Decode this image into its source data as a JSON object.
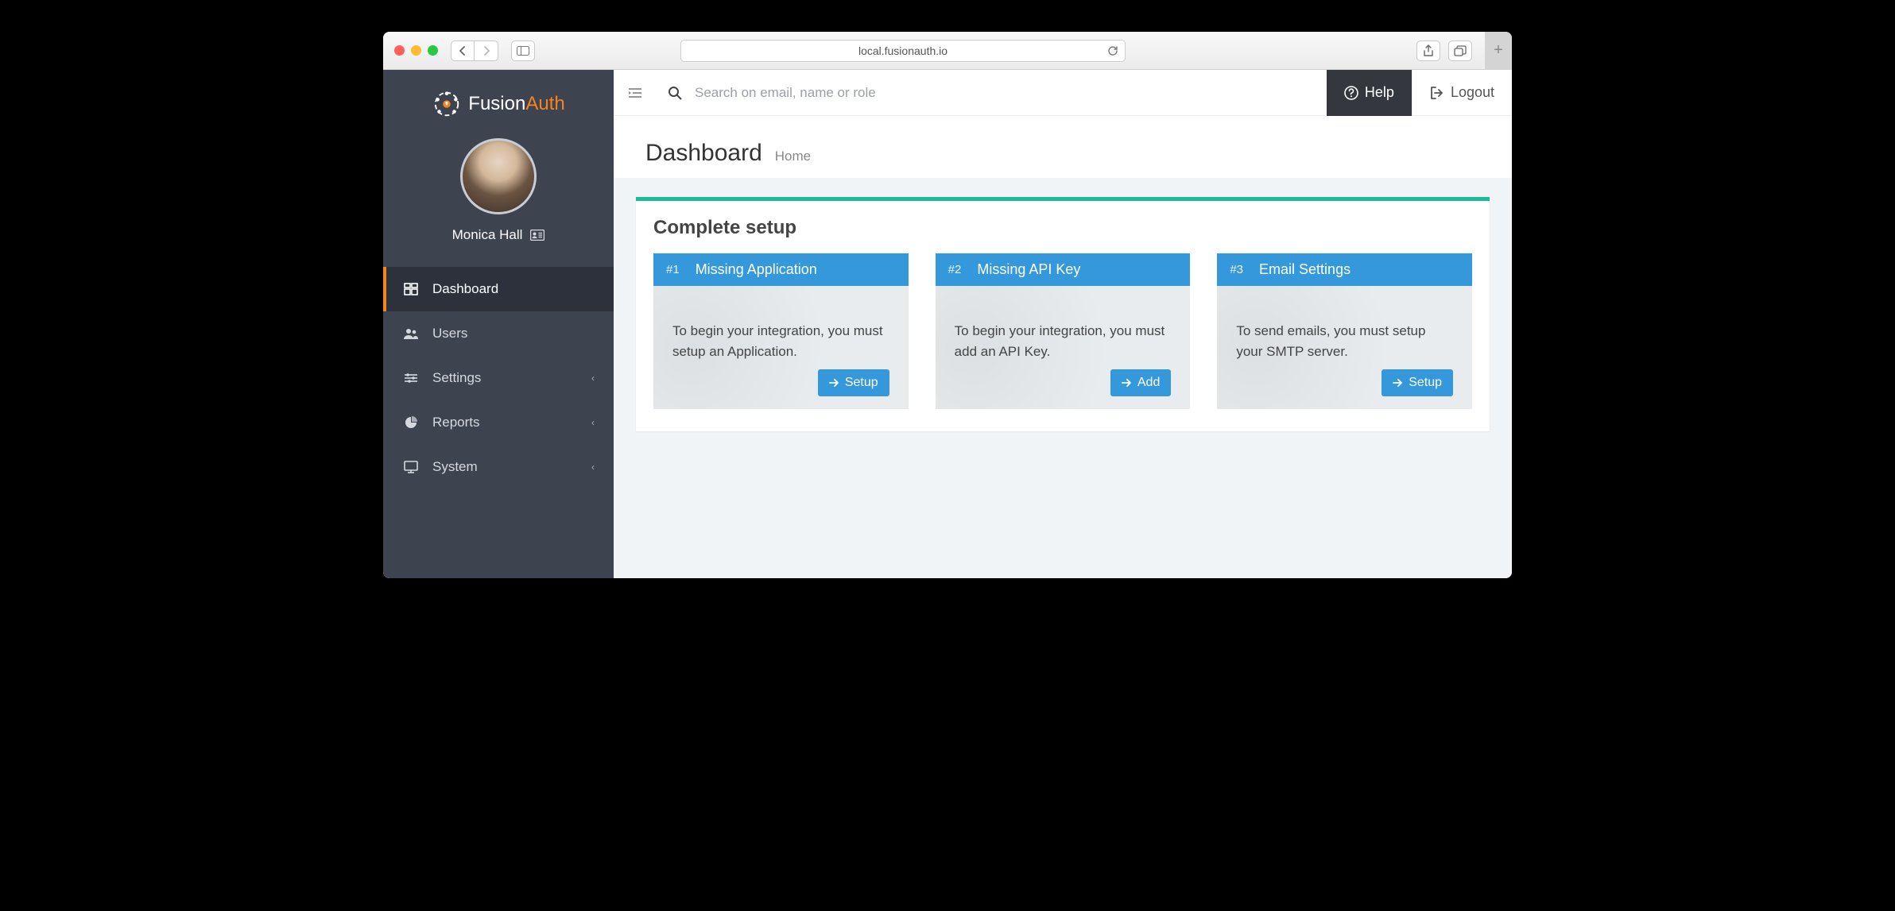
{
  "browser": {
    "url": "local.fusionauth.io"
  },
  "brand": {
    "name_primary": "Fusion",
    "name_secondary": "Auth",
    "accent": "#f58320",
    "teal": "#1abc9c",
    "blue": "#3498db"
  },
  "user": {
    "name": "Monica Hall"
  },
  "sidebar": {
    "items": [
      {
        "icon": "dashboard-icon",
        "label": "Dashboard",
        "active": true,
        "expandable": false
      },
      {
        "icon": "users-icon",
        "label": "Users",
        "active": false,
        "expandable": false
      },
      {
        "icon": "settings-icon",
        "label": "Settings",
        "active": false,
        "expandable": true
      },
      {
        "icon": "reports-icon",
        "label": "Reports",
        "active": false,
        "expandable": true
      },
      {
        "icon": "system-icon",
        "label": "System",
        "active": false,
        "expandable": true
      }
    ]
  },
  "topbar": {
    "search_placeholder": "Search on email, name or role",
    "help_label": "Help",
    "logout_label": "Logout"
  },
  "page": {
    "title": "Dashboard",
    "breadcrumb": "Home"
  },
  "panel": {
    "title": "Complete setup"
  },
  "cards": [
    {
      "num": "#1",
      "title": "Missing Application",
      "body": "To begin your integration, you must setup an Application.",
      "button": "Setup"
    },
    {
      "num": "#2",
      "title": "Missing API Key",
      "body": "To begin your integration, you must add an API Key.",
      "button": "Add"
    },
    {
      "num": "#3",
      "title": "Email Settings",
      "body": "To send emails, you must setup your SMTP server.",
      "button": "Setup"
    }
  ]
}
